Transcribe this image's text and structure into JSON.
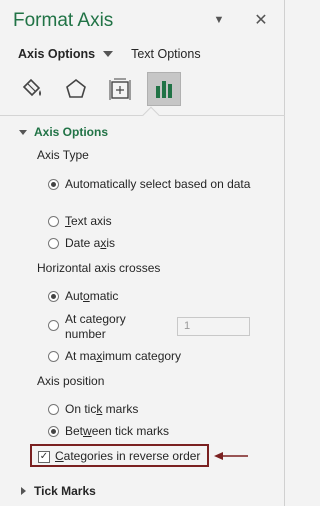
{
  "pane": {
    "title": "Format Axis",
    "tabs": [
      {
        "label": "Axis Options",
        "active": true
      },
      {
        "label": "Text Options",
        "active": false
      }
    ],
    "icons": [
      "fill-line-icon",
      "effects-icon",
      "size-properties-icon",
      "axis-options-chart-icon"
    ],
    "accent_color": "#217346"
  },
  "axis_options": {
    "header": "Axis Options",
    "axis_type": {
      "label": "Axis Type",
      "options": [
        {
          "pre": "",
          "u": "",
          "post": "Automatically select based on data",
          "selected": true
        },
        {
          "pre": "",
          "u": "T",
          "post": "ext axis",
          "selected": false
        },
        {
          "pre": "Date a",
          "u": "x",
          "post": "is",
          "selected": false
        }
      ]
    },
    "horizontal_crosses": {
      "label": "Horizontal axis crosses",
      "options": [
        {
          "pre": "Aut",
          "u": "o",
          "post": "matic",
          "selected": true
        },
        {
          "pre": "At cate",
          "u": "g",
          "post": "ory number",
          "selected": false
        },
        {
          "pre": "At ma",
          "u": "x",
          "post": "imum category",
          "selected": false
        }
      ],
      "category_number_value": "1"
    },
    "axis_position": {
      "label": "Axis position",
      "options": [
        {
          "pre": "On tic",
          "u": "k",
          "post": " marks",
          "selected": false
        },
        {
          "pre": "Bet",
          "u": "w",
          "post": "een tick marks",
          "selected": true
        }
      ]
    },
    "reverse_order": {
      "pre": "",
      "u": "C",
      "post": "ategories in reverse order",
      "checked": true
    }
  },
  "tick_marks": {
    "header": "Tick Marks"
  },
  "annotation": {
    "highlight_color": "#7a2020"
  }
}
